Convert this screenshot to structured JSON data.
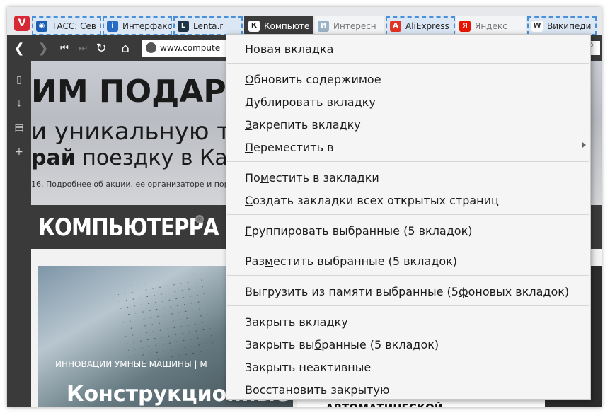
{
  "tabs": [
    {
      "title": "ТАСС: Сев",
      "favicon": "globe-icon",
      "icon_glyph": "◉",
      "color": "#1a5fb4",
      "state": "selected"
    },
    {
      "title": "Интерфакс",
      "favicon": "interfax-icon",
      "icon_glyph": "i",
      "color": "#2a6cc4",
      "state": "selected"
    },
    {
      "title": "Lenta.r",
      "favicon": "lenta-icon",
      "icon_glyph": "L",
      "color": "#1f3346",
      "state": "selected"
    },
    {
      "title": "Компьюте",
      "favicon": "computerra-icon",
      "icon_glyph": "К",
      "color": "#1b1b1b",
      "state": "active"
    },
    {
      "title": "Интересн",
      "favicon": "page-icon",
      "icon_glyph": "И",
      "color": "#9bb4c8",
      "state": "normal"
    },
    {
      "title": "AliExpress",
      "favicon": "aliexpress-icon",
      "icon_glyph": "A",
      "color": "#e43225",
      "state": "selected"
    },
    {
      "title": "Яндекс",
      "favicon": "yandex-icon",
      "icon_glyph": "Я",
      "color": "#e61400",
      "state": "normal"
    },
    {
      "title": "Википеди",
      "favicon": "wikipedia-icon",
      "icon_glyph": "W",
      "color": "#333333",
      "state": "selected"
    }
  ],
  "address": {
    "url": "www.compute"
  },
  "page": {
    "banner_line1": "ИМ ПОДАРКИ,",
    "banner_line2": "и уникальную тех",
    "banner_line3_bold": "рай",
    "banner_line3_rest": " поездку в Ка",
    "banner_small": "16. Подробнее об акции, ее организаторе и пор",
    "logo": "КОМПЬЮТЕРРА",
    "hero_categories": "ИННОВАЦИИ  УМНЫЕ МАШИНЫ   |   М",
    "hero_title": "Конструкционные",
    "side_card_text": "АВТОМАТИЧЕСКОЙ"
  },
  "menu": {
    "new_tab": {
      "pre": "",
      "key": "Н",
      "post": "овая вкладка"
    },
    "reload": {
      "pre": "",
      "key": "О",
      "post": "бновить содержимое"
    },
    "duplicate": {
      "pre": "",
      "key": "Д",
      "post": "ублировать вкладку"
    },
    "pin": {
      "pre": "",
      "key": "З",
      "post": "акрепить вкладку"
    },
    "move_to": {
      "pre": "",
      "key": "П",
      "post": "ереместить в"
    },
    "bookmark": {
      "pre": "По",
      "key": "м",
      "post": "естить в закладки"
    },
    "bookmark_all": {
      "pre": "",
      "key": "С",
      "post": "оздать закладки всех открытых страниц"
    },
    "group": {
      "pre": "",
      "key": "Г",
      "post": "руппировать выбранные (5 вкладок)"
    },
    "tile": {
      "pre": "Раз",
      "key": "м",
      "post": "естить выбранные (5 вкладок)"
    },
    "hibernate": {
      "pre": "Выгрузить из памяти выбранные (5 ",
      "key": "ф",
      "post": "оновых вкладок)"
    },
    "close_tab": {
      "pre": "Закрыть вкладку",
      "key": "",
      "post": ""
    },
    "close_selected": {
      "pre": "Закрыть вы",
      "key": "б",
      "post": "ранные (5 вкладок)"
    },
    "close_inactive": {
      "pre": "Закрыть неактивные",
      "key": "",
      "post": ""
    },
    "restore_closed": {
      "pre": "Восстановить закрыту",
      "key": "ю",
      "post": ""
    }
  }
}
